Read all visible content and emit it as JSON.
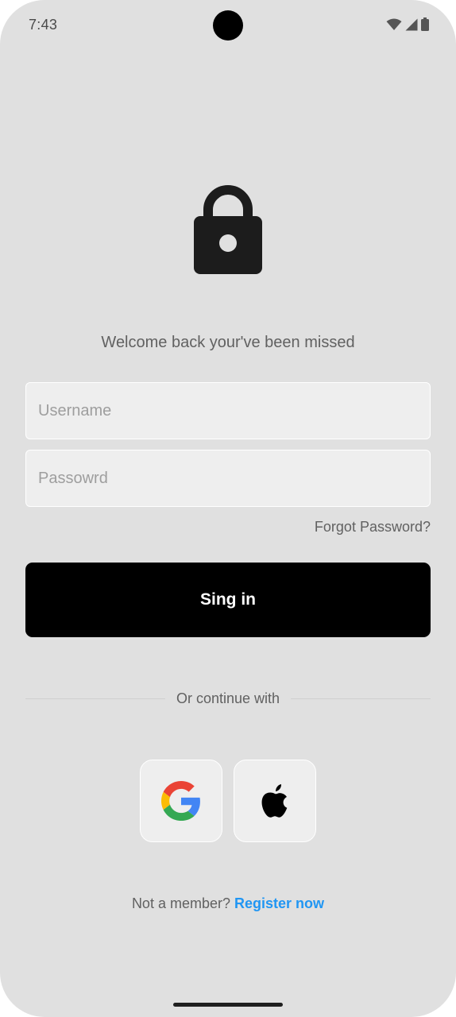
{
  "status_bar": {
    "time": "7:43",
    "icons": [
      "wifi-icon",
      "signal-icon",
      "battery-icon"
    ]
  },
  "header": {
    "icon": "lock-icon",
    "welcome": "Welcome back your've been missed"
  },
  "form": {
    "username": {
      "value": "",
      "placeholder": "Username"
    },
    "password": {
      "value": "",
      "placeholder": "Passowrd"
    },
    "forgot_label": "Forgot Password?",
    "signin_label": "Sing in"
  },
  "social": {
    "divider_label": "Or continue with",
    "providers": [
      "google-icon",
      "apple-icon"
    ]
  },
  "footer": {
    "prompt": "Not a member?",
    "register_label": "Register now"
  },
  "colors": {
    "background": "#e0e0e0",
    "field_background": "#eeeeee",
    "primary_button": "#000000",
    "link_accent": "#2196f3",
    "muted_text": "#616161"
  }
}
